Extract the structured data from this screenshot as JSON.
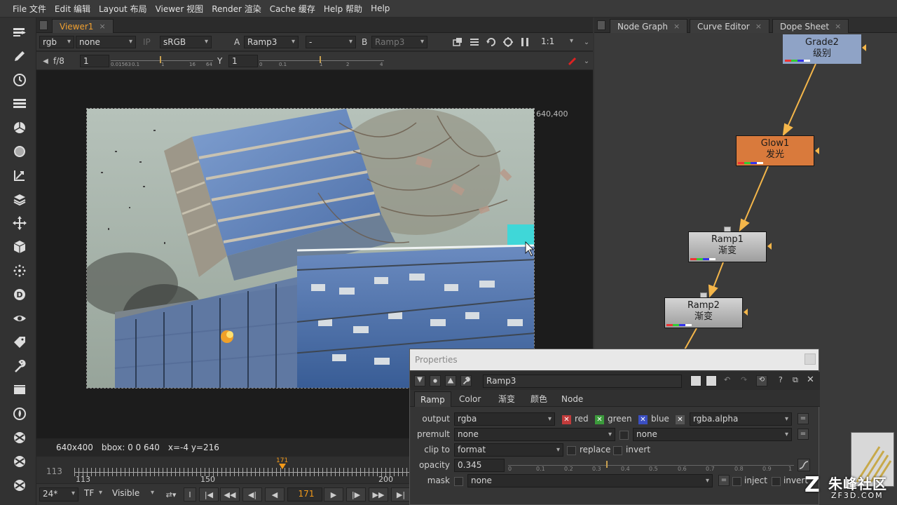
{
  "menubar": {
    "items": [
      "File 文件",
      "Edit 编辑",
      "Layout 布局",
      "Viewer 视图",
      "Render 渲染",
      "Cache 缓存",
      "Help 帮助",
      "Help"
    ]
  },
  "toolbar": {
    "icons": [
      "image-read-icon",
      "draw-icon",
      "time-icon",
      "channel-icon",
      "color-icon",
      "filter-icon",
      "keyer-icon",
      "merge-icon",
      "transform-icon",
      "3d-icon",
      "particles-icon",
      "deep-icon",
      "views-icon",
      "metadata-icon",
      "toolsets-icon",
      "other-icon",
      "furnace-icon",
      "ocula-icon",
      "ocula2-icon",
      "ocula3-icon"
    ]
  },
  "viewer": {
    "tab_label": "Viewer1",
    "tab_close": "×",
    "row1": {
      "channels": "rgb",
      "alpha_channel": "none",
      "ip_label": "IP",
      "lut": "sRGB",
      "a_label": "A",
      "a_input": "Ramp3",
      "compare_mode": "-",
      "b_label": "B",
      "b_input": "Ramp3",
      "zoom": "1:1"
    },
    "row2": {
      "fstop": "f/8",
      "gain_value": "1",
      "gain_ticks": [
        "0.01563",
        "0.1",
        "1",
        "16",
        "64"
      ],
      "y_label": "Y",
      "gamma_value": "1",
      "gamma_ticks": [
        "0",
        "0.1",
        "1",
        "2",
        "4"
      ]
    },
    "resolution_label": "640,400",
    "info": {
      "format": "640x400",
      "bbox": "bbox: 0 0 640",
      "coords": "x=-4 y=216"
    },
    "timeline": {
      "start_frame": "113",
      "ticks": [
        "113",
        "150",
        "200"
      ],
      "current_frame": "171"
    },
    "playback": {
      "fps": "24*",
      "tf": "TF",
      "visibility": "Visible",
      "frame": "171"
    }
  },
  "node_panel": {
    "tabs": [
      {
        "label": "Node Graph",
        "close": "×"
      },
      {
        "label": "Curve Editor",
        "close": "×"
      },
      {
        "label": "Dope Sheet",
        "close": "×"
      }
    ],
    "nodes": [
      {
        "name": "Grade2",
        "sub": "级别",
        "color": "#8fa3c6"
      },
      {
        "name": "Glow1",
        "sub": "发光",
        "color": "#d97a3c"
      },
      {
        "name": "Ramp1",
        "sub": "渐变",
        "color": "#bdbdbd"
      },
      {
        "name": "Ramp2",
        "sub": "渐变",
        "color": "#bdbdbd"
      }
    ],
    "link_color": "#f4b64a"
  },
  "properties": {
    "title": "Properties",
    "node_name": "Ramp3",
    "tabs": [
      "Ramp",
      "Color",
      "渐变",
      "颜色",
      "Node"
    ],
    "rows": {
      "output": {
        "label": "output",
        "value": "rgba",
        "red": "red",
        "green": "green",
        "blue": "blue",
        "alpha": "rgba.alpha"
      },
      "premult": {
        "label": "premult",
        "value": "none",
        "value2": "none"
      },
      "clip_to": {
        "label": "clip to",
        "value": "format",
        "replace": "replace",
        "invert": "invert"
      },
      "opacity": {
        "label": "opacity",
        "value": "0.345",
        "ticks": [
          "0",
          "0.1",
          "0.2",
          "0.3",
          "0.4",
          "0.5",
          "0.6",
          "0.7",
          "0.8",
          "0.9",
          "1"
        ]
      },
      "mask": {
        "label": "mask",
        "value": "none",
        "inject": "inject",
        "invert": "invert"
      }
    }
  },
  "watermark": {
    "text": "朱峰社区",
    "url": "ZF3D.COM"
  }
}
